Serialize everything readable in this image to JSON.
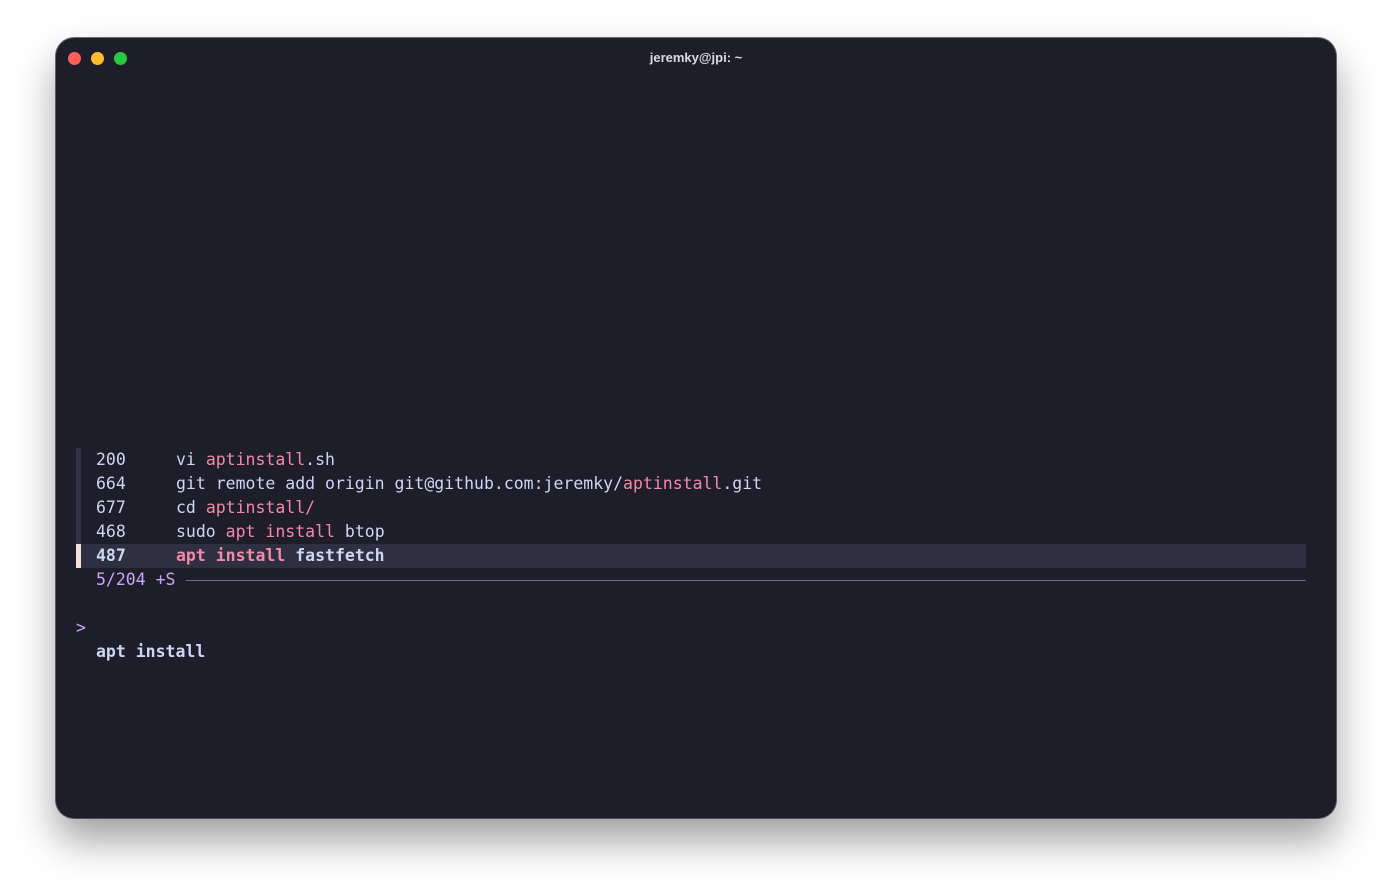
{
  "window": {
    "title": "jeremky@jpi: ~"
  },
  "history": {
    "results": [
      {
        "num": "200",
        "parts": [
          {
            "text": "vi ",
            "hl": false
          },
          {
            "text": "aptinstall",
            "hl": true
          },
          {
            "text": ".sh",
            "hl": false
          }
        ]
      },
      {
        "num": "664",
        "parts": [
          {
            "text": "git remote add origin git@github.com:jeremky/",
            "hl": false
          },
          {
            "text": "aptinstall",
            "hl": true
          },
          {
            "text": ".git",
            "hl": false
          }
        ]
      },
      {
        "num": "677",
        "parts": [
          {
            "text": "cd ",
            "hl": false
          },
          {
            "text": "aptinstall/",
            "hl": true
          }
        ]
      },
      {
        "num": "468",
        "parts": [
          {
            "text": "sudo ",
            "hl": false
          },
          {
            "text": "apt install",
            "hl": true
          },
          {
            "text": " btop",
            "hl": false
          }
        ]
      },
      {
        "num": "487",
        "selected": true,
        "parts": [
          {
            "text": "apt install",
            "hl": true
          },
          {
            "text": " fastfetch",
            "hl": false
          }
        ]
      }
    ],
    "match_count": "5/204 +S",
    "prompt_symbol": ">",
    "query": "apt install"
  },
  "colors": {
    "background": "#1e1e2a",
    "highlight": "#f38ba8",
    "accent": "#cba6f7",
    "text": "#cdd6f4",
    "selected_bar": "#f5e0dc"
  }
}
